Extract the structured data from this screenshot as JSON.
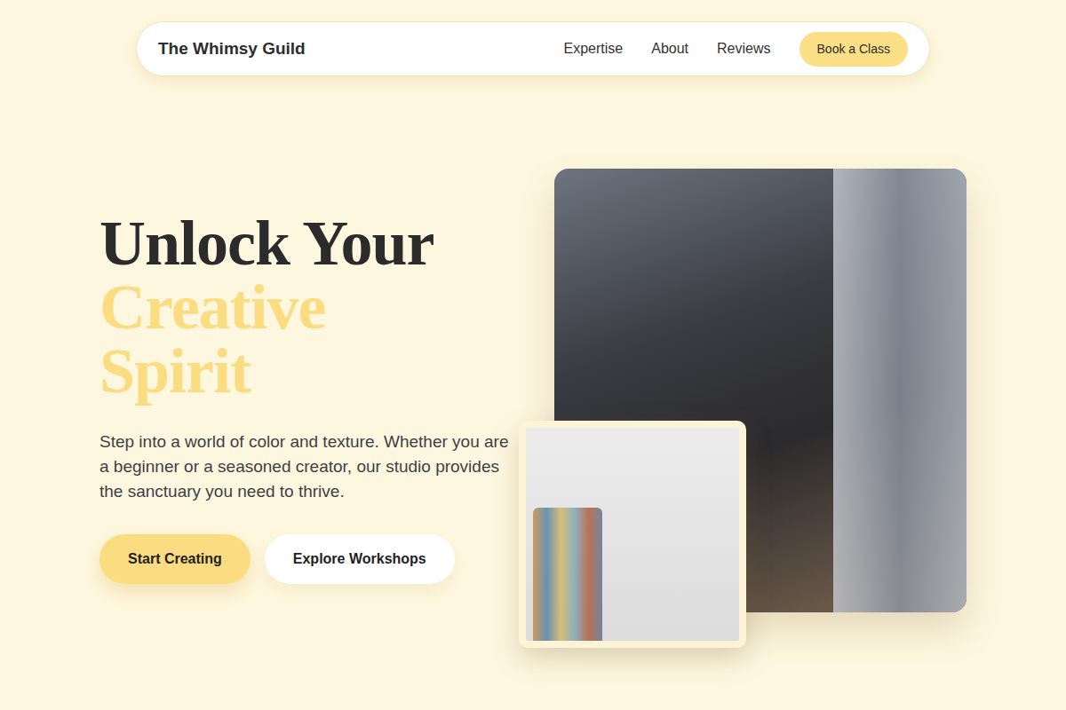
{
  "nav": {
    "brand": "The Whimsy Guild",
    "links": [
      "Expertise",
      "About",
      "Reviews"
    ],
    "cta": "Book a Class"
  },
  "hero": {
    "heading": "Unlock Your",
    "highlight": "Creative Spirit",
    "text": "Step into a world of color and texture. Whether you are a beginner or a seasoned creator, our studio provides the sanctuary you need to thrive.",
    "buttons": [
      {
        "label": "Start Creating",
        "kind": "primary"
      },
      {
        "label": "Explore Workshops",
        "kind": "secondary"
      }
    ]
  }
}
